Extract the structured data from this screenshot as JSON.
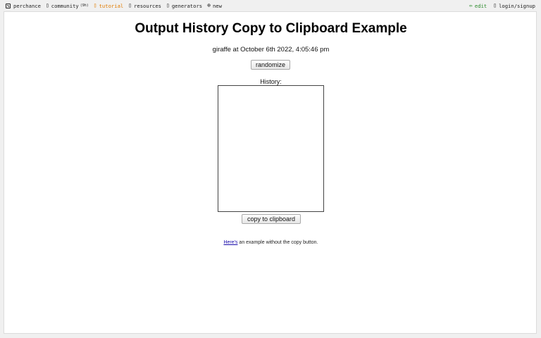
{
  "nav": {
    "left": [
      {
        "id": "perchance",
        "icon": "dice-icon",
        "label": "perchance"
      },
      {
        "id": "community",
        "icon": "chat-icon",
        "label": "community",
        "count": "(9h)"
      },
      {
        "id": "tutorial",
        "icon": "book-icon",
        "label": "tutorial"
      },
      {
        "id": "resources",
        "icon": "folder-icon",
        "label": "resources"
      },
      {
        "id": "generators",
        "icon": "grid-icon",
        "label": "generators"
      },
      {
        "id": "new",
        "icon": "plus-circle-icon",
        "label": "new"
      }
    ],
    "right": [
      {
        "id": "edit",
        "icon": "pencil-icon",
        "label": "edit"
      },
      {
        "id": "login",
        "icon": "user-icon",
        "label": "login/signup"
      }
    ]
  },
  "colors": {
    "tutorial": "#e07b00",
    "edit": "#2a8a2a",
    "link": "#1a0dab"
  },
  "page": {
    "title": "Output History Copy to Clipboard Example",
    "output": "giraffe at October 6th 2022, 4:05:46 pm",
    "randomize_label": "randomize",
    "history_label": "History:",
    "history_value": "",
    "copy_label": "copy to clipboard",
    "footer_link": "Here's",
    "footer_text": " an example without the copy button."
  }
}
